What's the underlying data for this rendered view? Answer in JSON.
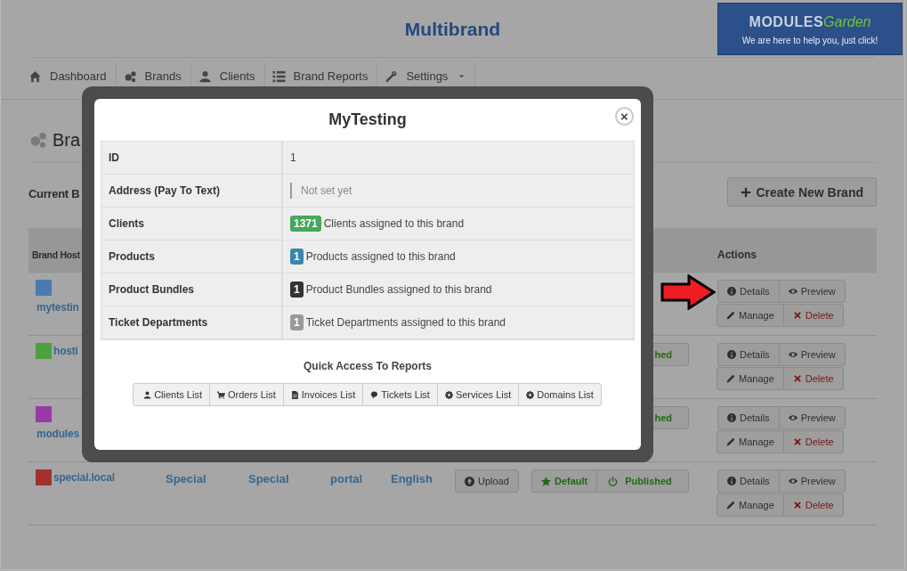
{
  "header": {
    "title": "Multibrand"
  },
  "banner": {
    "brand_first": "MODULES",
    "brand_second": "Garden",
    "tagline": "We are here to help you, just click!"
  },
  "nav": [
    {
      "label": "Dashboard",
      "dropdown": false
    },
    {
      "label": "Brands",
      "dropdown": false
    },
    {
      "label": "Clients",
      "dropdown": false
    },
    {
      "label": "Brand Reports",
      "dropdown": false
    },
    {
      "label": "Settings",
      "dropdown": true
    }
  ],
  "page": {
    "heading": "Bra",
    "subheading": "Current B",
    "create_button": "Create New Brand"
  },
  "table": {
    "columns": [
      "Brand Host",
      "Actions"
    ],
    "rows": [
      {
        "host": "mytestin",
        "color": "#4a7ab0",
        "kind": "stacked",
        "actions": [
          {
            "label": "Details",
            "danger": false
          },
          {
            "label": "Preview",
            "danger": false
          },
          {
            "label": "Manage",
            "danger": false
          },
          {
            "label": "Delete",
            "danger": true
          }
        ]
      },
      {
        "host": "hosti",
        "color": "#4ea03f",
        "kind": "inline",
        "status": [
          {
            "label": "hed",
            "kind": "cut"
          }
        ],
        "actions": [
          {
            "label": "Details",
            "danger": false
          },
          {
            "label": "Preview",
            "danger": false
          },
          {
            "label": "Manage",
            "danger": false
          },
          {
            "label": "Delete",
            "danger": true
          }
        ]
      },
      {
        "host": "modules",
        "color": "#9b38a8",
        "kind": "stacked",
        "status": [
          {
            "label": "hed",
            "kind": "cut"
          }
        ],
        "actions": [
          {
            "label": "Details",
            "danger": false
          },
          {
            "label": "Preview",
            "danger": false
          },
          {
            "label": "Manage",
            "danger": false
          },
          {
            "label": "Delete",
            "danger": true
          }
        ]
      },
      {
        "host": "special.local",
        "color": "#a23232",
        "kind": "inline",
        "cells": [
          "Special",
          "Special",
          "portal",
          "English"
        ],
        "upload": "Upload",
        "status": [
          {
            "label": "Default",
            "kind": "default"
          },
          {
            "label": "Published",
            "kind": "published"
          }
        ],
        "actions": [
          {
            "label": "Details",
            "danger": false
          },
          {
            "label": "Preview",
            "danger": false
          },
          {
            "label": "Manage",
            "danger": false
          },
          {
            "label": "Delete",
            "danger": true
          }
        ]
      }
    ]
  },
  "modal": {
    "title": "MyTesting",
    "close": "×",
    "rows": [
      {
        "label": "ID",
        "kind": "text",
        "value": "1"
      },
      {
        "label": "Address (Pay To Text)",
        "kind": "quote",
        "value": "Not set yet"
      },
      {
        "label": "Clients",
        "kind": "badge",
        "badge": "1371",
        "color": "#47a85c",
        "value": "Clients assigned to this brand"
      },
      {
        "label": "Products",
        "kind": "badge",
        "badge": "1",
        "color": "#3a87ad",
        "value": "Products assigned to this brand"
      },
      {
        "label": "Product Bundles",
        "kind": "badge",
        "badge": "1",
        "color": "#333333",
        "value": "Product Bundles assigned to this brand"
      },
      {
        "label": "Ticket Departments",
        "kind": "badge",
        "badge": "1",
        "color": "#999999",
        "value": "Ticket Departments assigned to this brand"
      }
    ],
    "reports_title": "Quick Access To Reports",
    "reports": [
      "Clients List",
      "Orders List",
      "Invoices List",
      "Tickets List",
      "Services List",
      "Domains List"
    ]
  }
}
